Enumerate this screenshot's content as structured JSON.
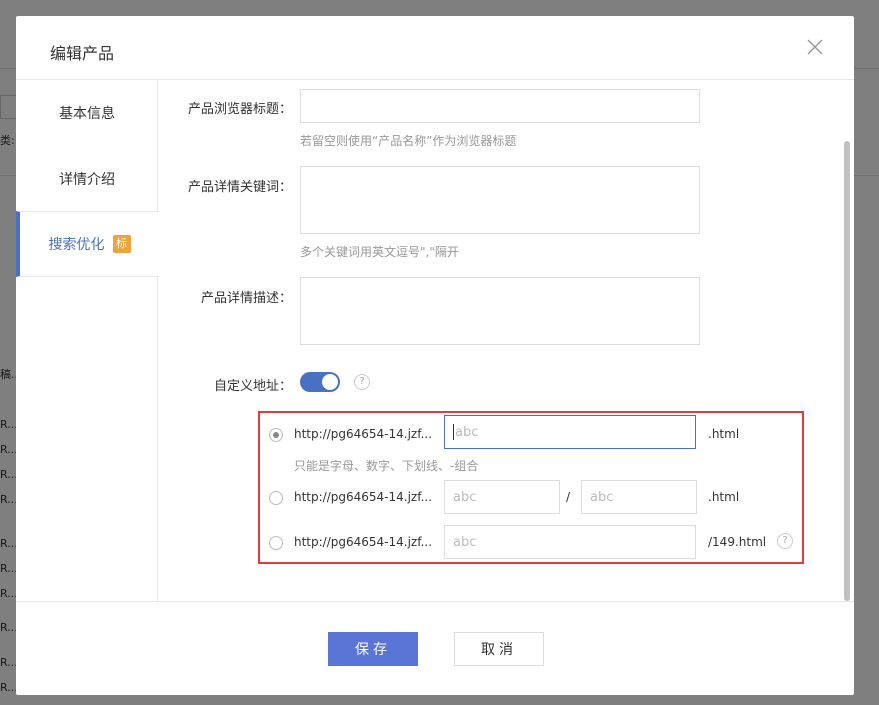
{
  "background": {
    "label_partial": "类:",
    "row_chars": [
      "稿...",
      "R...",
      "R...",
      "R...",
      "R...",
      "R...",
      "R...",
      "R...",
      "R...",
      "R...",
      "R...",
      "R..."
    ]
  },
  "modal": {
    "title": "编辑产品"
  },
  "sidebar": {
    "tabs": [
      {
        "label": "基本信息"
      },
      {
        "label": "详情介绍"
      },
      {
        "label": "搜索优化",
        "badge": "标"
      }
    ]
  },
  "form": {
    "browser_title": {
      "label": "产品浏览器标题：",
      "value": "",
      "hint": "若留空则使用“产品名称”作为浏览器标题"
    },
    "keywords": {
      "label": "产品详情关键词：",
      "value": "",
      "hint": "多个关键词用英文逗号\",\"隔开"
    },
    "description": {
      "label": "产品详情描述：",
      "value": ""
    },
    "custom_url": {
      "label": "自定义地址：",
      "enabled": true,
      "help": "?",
      "options": [
        {
          "prefix": "http://pg64654-14.jzf...",
          "input_placeholder": "abc",
          "suffix": ".html",
          "selected": true,
          "hint": "只能是字母、数字、下划线、-组合"
        },
        {
          "prefix": "http://pg64654-14.jzf...",
          "input_placeholder": "abc",
          "separator": "/",
          "input2_placeholder": "abc",
          "suffix": ".html",
          "selected": false
        },
        {
          "prefix": "http://pg64654-14.jzf...",
          "input_placeholder": "abc",
          "suffix": "/149.html",
          "selected": false,
          "help": "?"
        }
      ]
    }
  },
  "footer": {
    "save_label": "保存",
    "cancel_label": "取消"
  },
  "colors": {
    "accent": "#4a70c6",
    "save_button": "#5a75d6",
    "badge": "#f0a33a",
    "highlight_border": "#e23b3b"
  }
}
